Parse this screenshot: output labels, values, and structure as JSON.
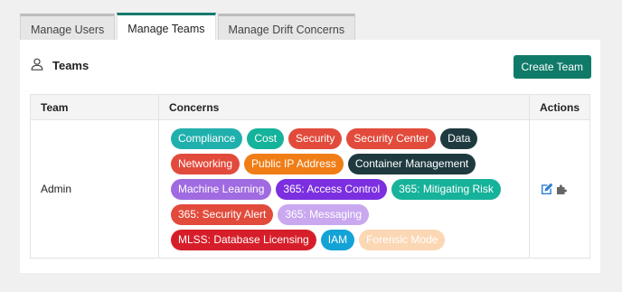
{
  "tabs": [
    {
      "label": "Manage Users",
      "active": false
    },
    {
      "label": "Manage Teams",
      "active": true
    },
    {
      "label": "Manage Drift Concerns",
      "active": false
    }
  ],
  "panel": {
    "title": "Teams",
    "title_icon": "user-icon",
    "create_button_label": "Create Team"
  },
  "table": {
    "headers": [
      "Team",
      "Concerns",
      "Actions"
    ],
    "rows": [
      {
        "team": "Admin",
        "concerns": [
          {
            "label": "Compliance",
            "bg": "#1fb0ad",
            "color": "#ffffff"
          },
          {
            "label": "Cost",
            "bg": "#14b39a",
            "color": "#ffffff"
          },
          {
            "label": "Security",
            "bg": "#e24b3c",
            "color": "#ffffff"
          },
          {
            "label": "Security Center",
            "bg": "#e24b3c",
            "color": "#ffffff"
          },
          {
            "label": "Data",
            "bg": "#1f3a3f",
            "color": "#ffffff"
          },
          {
            "label": "Networking",
            "bg": "#e24b3c",
            "color": "#ffffff"
          },
          {
            "label": "Public IP Address",
            "bg": "#f07d16",
            "color": "#ffffff"
          },
          {
            "label": "Container Management",
            "bg": "#1f3a3f",
            "color": "#ffffff"
          },
          {
            "label": "Machine Learning",
            "bg": "#a06ae0",
            "color": "#ffffff"
          },
          {
            "label": "365: Access Control",
            "bg": "#7b2fe0",
            "color": "#ffffff"
          },
          {
            "label": "365: Mitigating Risk",
            "bg": "#16b29a",
            "color": "#ffffff"
          },
          {
            "label": "365: Security Alert",
            "bg": "#e24b3c",
            "color": "#ffffff"
          },
          {
            "label": "365: Messaging",
            "bg": "#c9a8f0",
            "color": "#ffffff"
          },
          {
            "label": "MLSS: Database Licensing",
            "bg": "#d61e2a",
            "color": "#ffffff"
          },
          {
            "label": "IAM",
            "bg": "#14a3d6",
            "color": "#ffffff"
          },
          {
            "label": "Forensic Mode",
            "bg": "#fbd7b4",
            "color": "#ffffff"
          }
        ],
        "actions": [
          "edit-icon",
          "puzzle-icon"
        ]
      }
    ]
  },
  "colors": {
    "accent": "#107a68",
    "edit_icon": "#2a7fd4",
    "puzzle_icon": "#666666"
  }
}
